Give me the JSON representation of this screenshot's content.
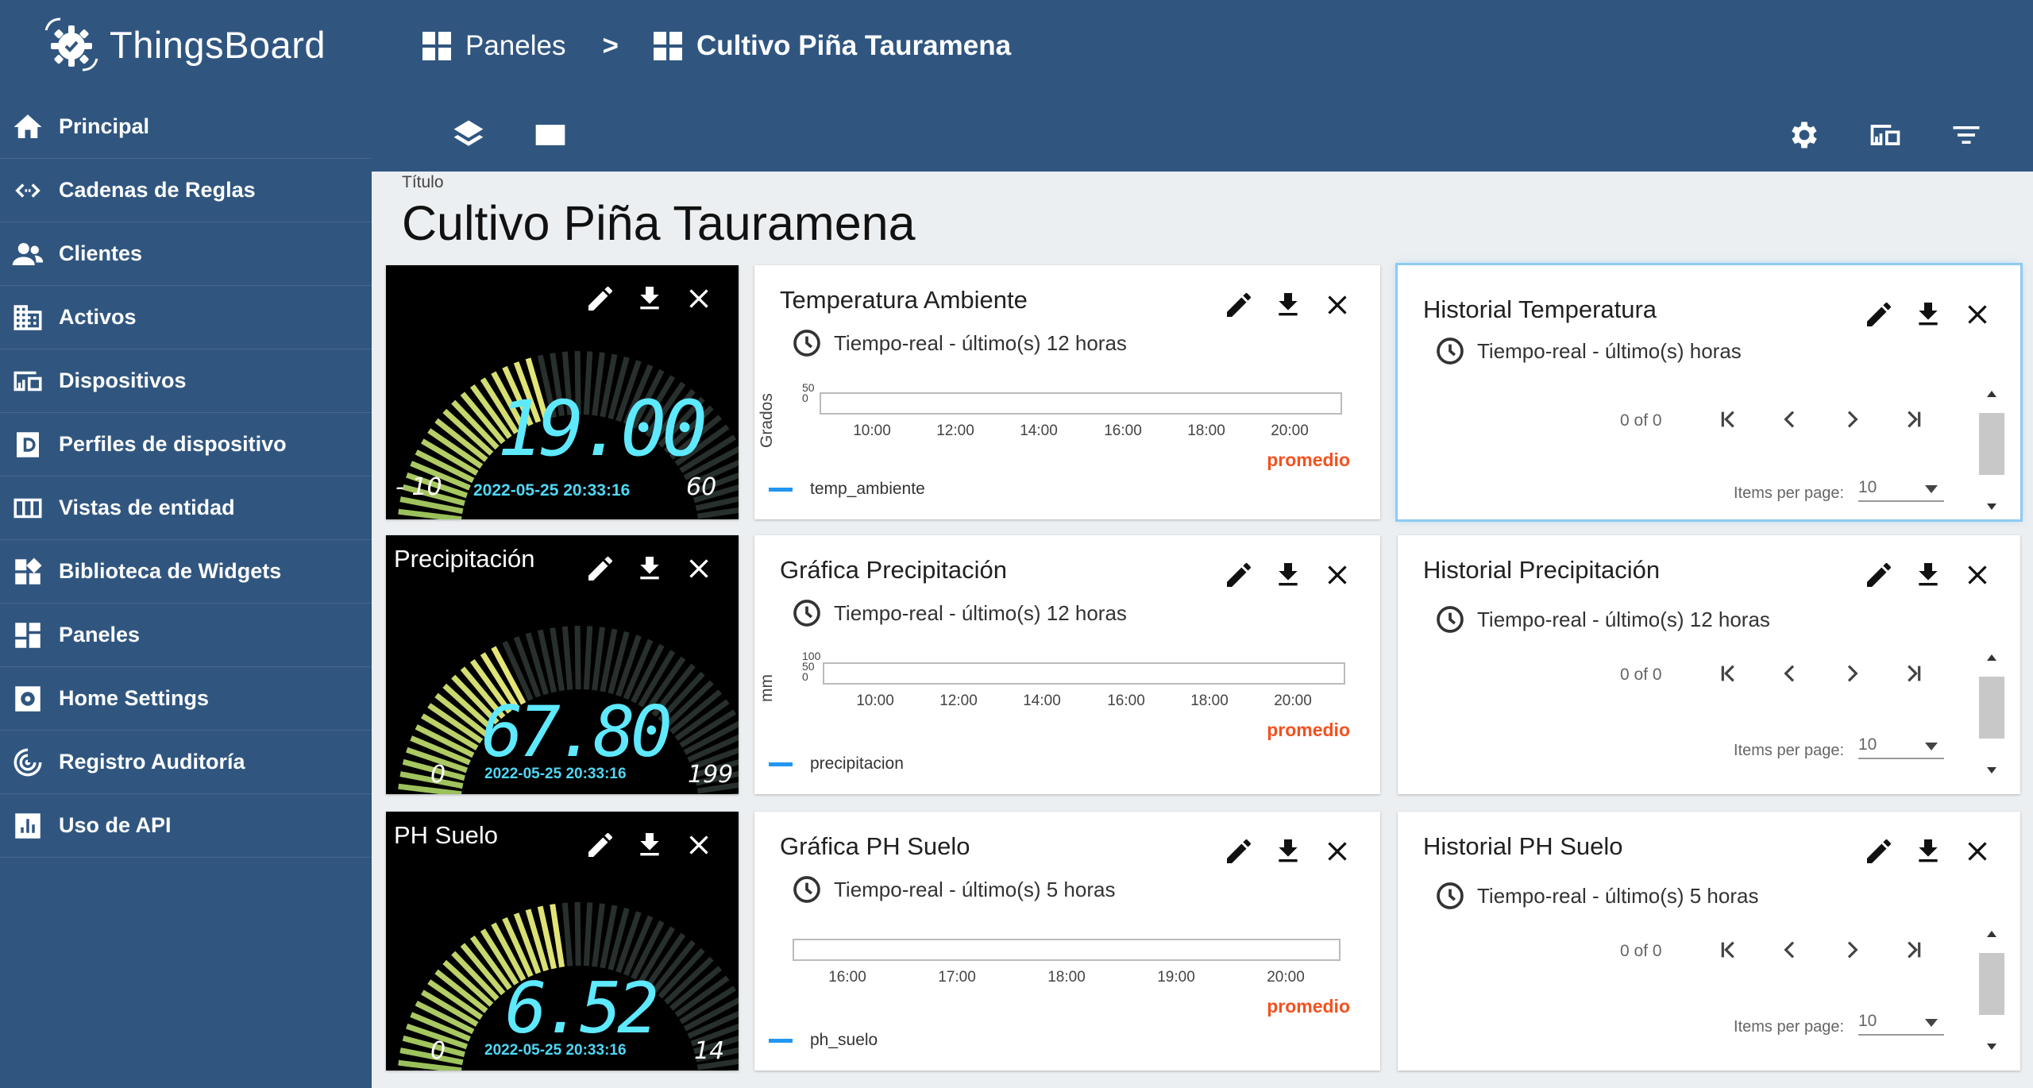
{
  "app": {
    "name": "ThingsBoard"
  },
  "breadcrumb": {
    "parent": "Paneles",
    "separator": ">",
    "current": "Cultivo Piña Tauramena"
  },
  "sidebar": {
    "items": [
      {
        "label": "Principal",
        "icon": "home-icon"
      },
      {
        "label": "Cadenas de Reglas",
        "icon": "code-arrows-icon"
      },
      {
        "label": "Clientes",
        "icon": "people-icon"
      },
      {
        "label": "Activos",
        "icon": "building-icon"
      },
      {
        "label": "Dispositivos",
        "icon": "devices-icon"
      },
      {
        "label": "Perfiles de dispositivo",
        "icon": "device-profile-icon"
      },
      {
        "label": "Vistas de entidad",
        "icon": "entity-view-icon"
      },
      {
        "label": "Biblioteca de Widgets",
        "icon": "widgets-icon"
      },
      {
        "label": "Paneles",
        "icon": "dashboard-icon"
      },
      {
        "label": "Home Settings",
        "icon": "settings-box-icon"
      },
      {
        "label": "Registro Auditoría",
        "icon": "audit-icon"
      },
      {
        "label": "Uso de API",
        "icon": "chart-box-icon"
      }
    ]
  },
  "dashboard": {
    "title_label": "Título",
    "title": "Cultivo Piña Tauramena"
  },
  "gauges": [
    {
      "title": "",
      "value": "19.00",
      "timestamp": "2022-05-25 20:33:16",
      "min": "- 10",
      "max": "60",
      "min_num": -10,
      "max_num": 60,
      "val_num": 19.0
    },
    {
      "title": "Precipitación",
      "value": "67.80",
      "timestamp": "2022-05-25 20:33:16",
      "min": "0",
      "max": "199",
      "min_num": 0,
      "max_num": 199,
      "val_num": 67.8
    },
    {
      "title": "PH Suelo",
      "value": "6.52",
      "timestamp": "2022-05-25 20:33:16",
      "min": "0",
      "max": "14",
      "min_num": 0,
      "max_num": 14,
      "val_num": 6.52
    }
  ],
  "charts": [
    {
      "title": "Temperatura Ambiente",
      "timewindow": "Tiempo-real - último(s) 12 horas",
      "ylabel": "Grados",
      "yticks": [
        "50",
        "0"
      ],
      "xticks": [
        "10:00",
        "12:00",
        "14:00",
        "16:00",
        "18:00",
        "20:00"
      ],
      "aggregation": "promedio",
      "legend": "temp_ambiente"
    },
    {
      "title": "Gráfica Precipitación",
      "timewindow": "Tiempo-real - último(s) 12 horas",
      "ylabel": "mm",
      "yticks": [
        "100",
        "50",
        "0"
      ],
      "xticks": [
        "10:00",
        "12:00",
        "14:00",
        "16:00",
        "18:00",
        "20:00"
      ],
      "aggregation": "promedio",
      "legend": "precipitacion"
    },
    {
      "title": "Gráfica PH Suelo",
      "timewindow": "Tiempo-real - último(s) 5 horas",
      "ylabel": "",
      "yticks": [
        "",
        ""
      ],
      "xticks": [
        "16:00",
        "17:00",
        "18:00",
        "19:00",
        "20:00"
      ],
      "aggregation": "promedio",
      "legend": "ph_suelo"
    }
  ],
  "tables": [
    {
      "title": "Historial Temperatura",
      "timewindow": "Tiempo-real - último(s) horas",
      "count": "0 of 0",
      "items_label": "Items per page:",
      "items_value": "10"
    },
    {
      "title": "Historial Precipitación",
      "timewindow": "Tiempo-real - último(s) 12 horas",
      "count": "0 of 0",
      "items_label": "Items per page:",
      "items_value": "10"
    },
    {
      "title": "Historial PH Suelo",
      "timewindow": "Tiempo-real - último(s) 5 horas",
      "count": "0 of 0",
      "items_label": "Items per page:",
      "items_value": "10"
    }
  ],
  "colors": {
    "header": "#305680",
    "accent_agg": "#f4511e",
    "legend_line": "#2196f3",
    "gauge_text": "#5ee9ff"
  }
}
